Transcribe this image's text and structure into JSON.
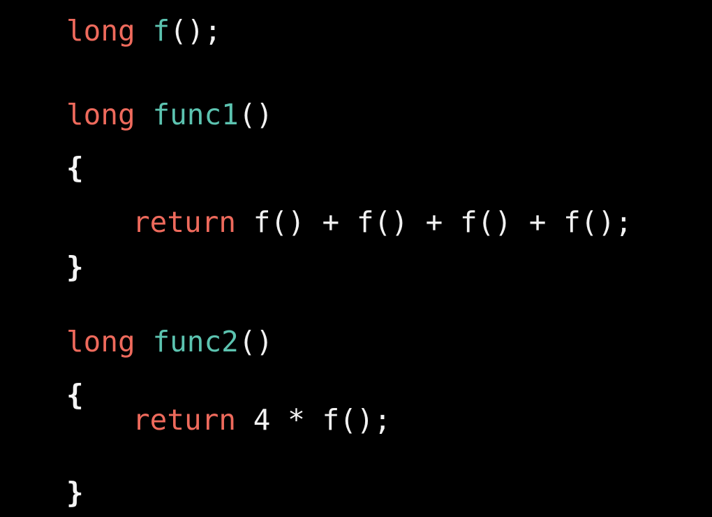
{
  "colors": {
    "background": "#000000",
    "keyword": "#ee6a5c",
    "function_name": "#5cc3b0",
    "plain": "#f2f2f2"
  },
  "code": {
    "decl": {
      "type": "long",
      "name": "f",
      "rest": "();"
    },
    "func1": {
      "type": "long",
      "name": "func1",
      "params": "()",
      "open": "{",
      "ret_kw": "return",
      "ret_expr": "f() + f() + f() + f();",
      "close": "}"
    },
    "func2": {
      "type": "long",
      "name": "func2",
      "params": "()",
      "open": "{",
      "ret_kw": "return",
      "ret_expr": "4 * f();",
      "close": "}"
    }
  }
}
